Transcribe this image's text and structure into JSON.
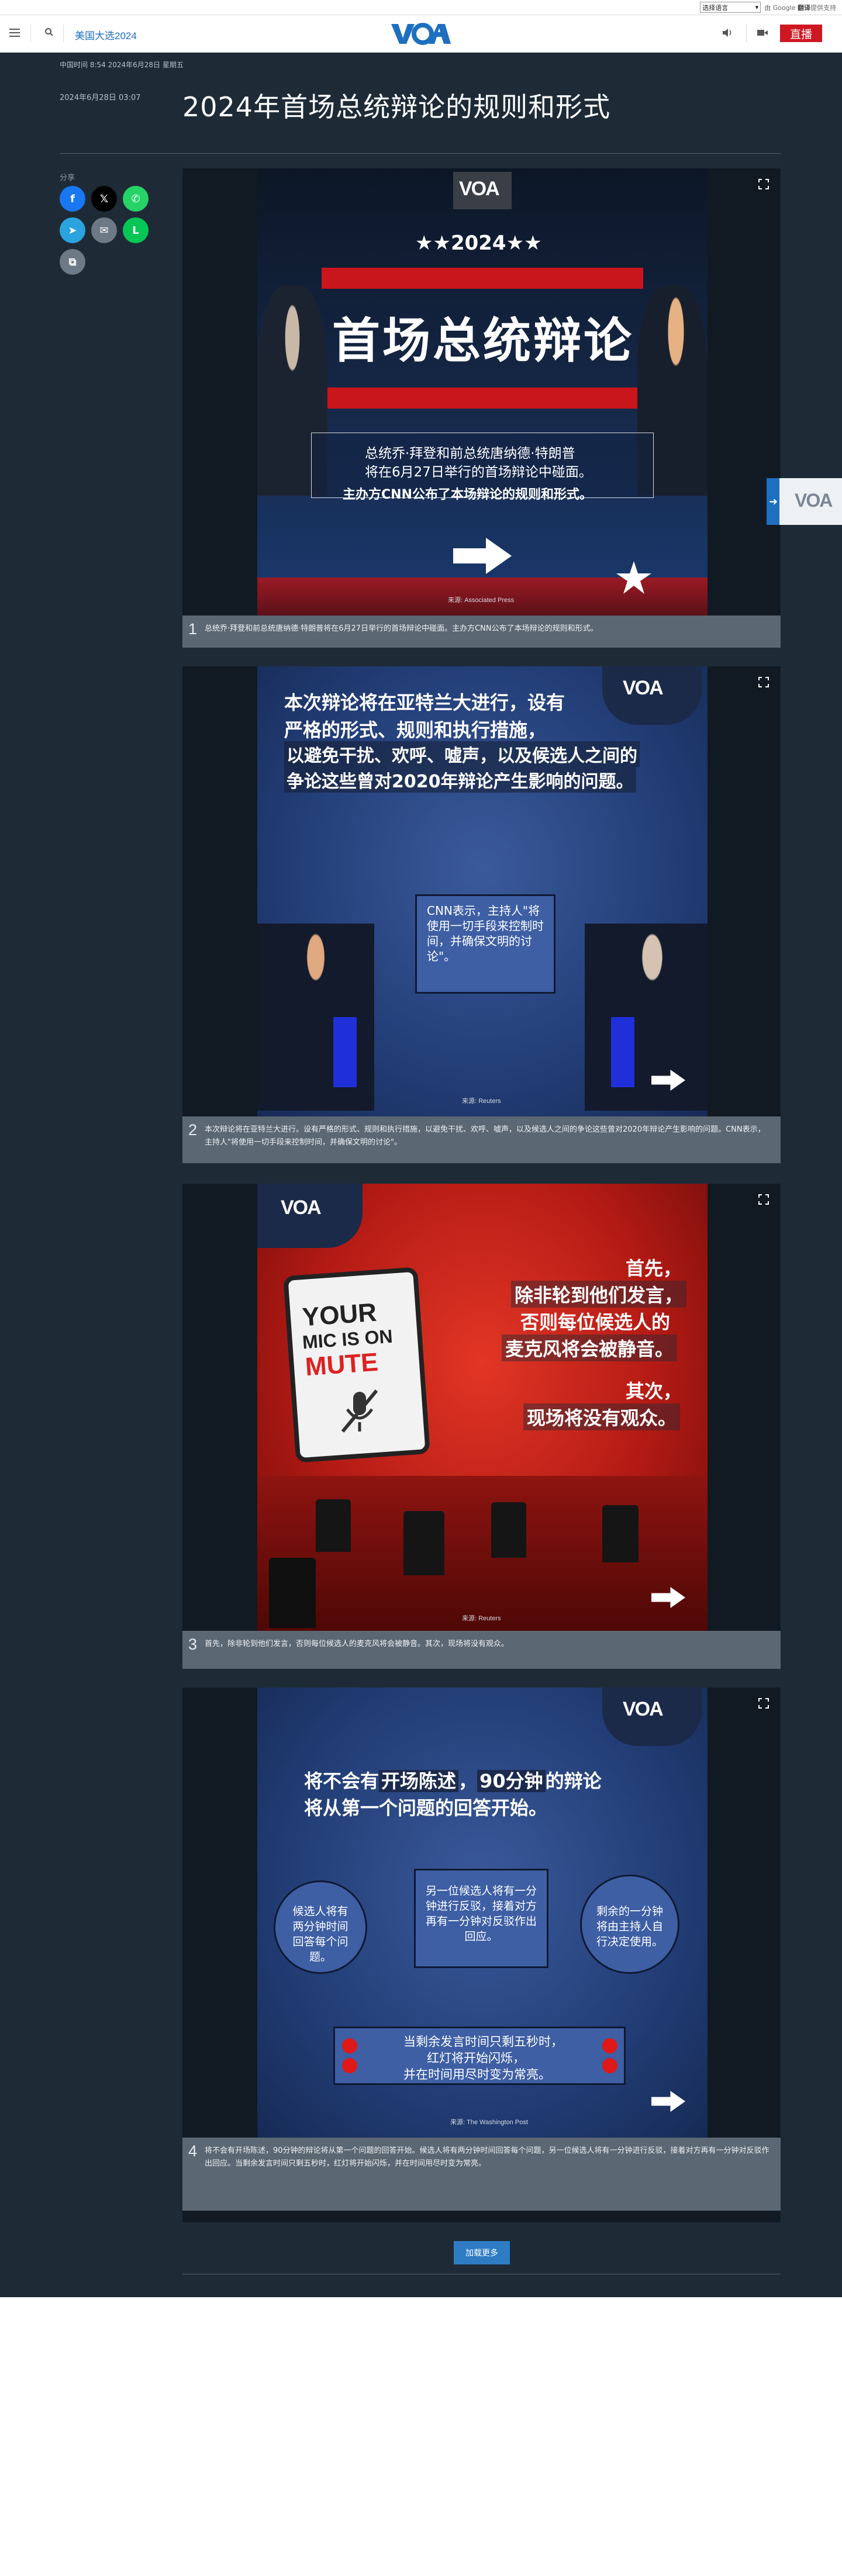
{
  "translate": {
    "select_label": "选择语言",
    "powered_prefix": "由 Google",
    "powered_brand": "翻译",
    "powered_suffix": "提供支持"
  },
  "header": {
    "section": "美国大选2024",
    "logo": "VOA",
    "live_label": "直播"
  },
  "article": {
    "meta_top": "中国时间 8:54 2024年6月28日 星期五",
    "date": "2024年6月28日 03:07",
    "title": "2024年首场总统辩论的规则和形式",
    "share_label": "分享"
  },
  "share_buttons": [
    {
      "name": "facebook",
      "glyph": "f",
      "color": "#1877f2"
    },
    {
      "name": "x",
      "glyph": "𝕏",
      "color": "#000000"
    },
    {
      "name": "whatsapp",
      "glyph": "✆",
      "color": "#25d366"
    },
    {
      "name": "telegram",
      "glyph": "➤",
      "color": "#2aa3de"
    },
    {
      "name": "email",
      "glyph": "✉",
      "color": "#6d7a86"
    },
    {
      "name": "line",
      "glyph": "L",
      "color": "#06c755"
    },
    {
      "name": "copy-link",
      "glyph": "⧉",
      "color": "#6d7a86"
    }
  ],
  "slides": [
    {
      "number": "1",
      "caption": "总统乔·拜登和前总统唐纳德·特朗普将在6月27日举行的首场辩论中碰面。主办方CNN公布了本场辩论的规则和形式。",
      "graphic": {
        "year": "★★2024★★",
        "headline": "首场总统辩论",
        "line1": "总统乔·拜登和前总统唐纳德·特朗普",
        "line2": "将在6月27日举行的首场辩论中碰面。",
        "line3": "主办方CNN公布了本场辩论的规则和形式。",
        "source": "来源: Associated Press"
      }
    },
    {
      "number": "2",
      "caption": "本次辩论将在亚特兰大进行。设有严格的形式、规则和执行措施，以避免干扰、欢呼、嘘声，以及候选人之间的争论这些曾对2020年辩论产生影响的问题。CNN表示，主持人\"将使用一切手段来控制时间，并确保文明的讨论\"。",
      "graphic": {
        "l1": "本次辩论将在亚特兰大进行，设有",
        "l2": "严格的形式、规则和执行措施，",
        "l3": "以避免干扰、欢呼、嘘声，以及候选人之间的",
        "l4": "争论这些曾对2020年辩论产生影响的问题。",
        "bubble": "CNN表示，主持人\"将使用一切手段来控制时间，并确保文明的讨论\"。",
        "source": "来源: Reuters"
      }
    },
    {
      "number": "3",
      "caption": "首先，除非轮到他们发言，否则每位候选人的麦克风将会被静音。其次，现场将没有观众。",
      "graphic": {
        "sign1": "YOUR",
        "sign2": "MIC IS ON",
        "sign3": "MUTE",
        "t1": "首先，",
        "t2": "除非轮到他们发言，",
        "t3": "否则每位候选人的",
        "t4": "麦克风将会被静音。",
        "t5": "其次，",
        "t6": "现场将没有观众。",
        "source": "来源: Reuters"
      }
    },
    {
      "number": "4",
      "caption": "将不会有开场陈述，90分钟的辩论将从第一个问题的回答开始。候选人将有两分钟时间回答每个问题，另一位候选人将有一分钟进行反驳，接着对方再有一分钟对反驳作出回应。当剩余发言时间只剩五秒时，红灯将开始闪烁，并在时间用尽时变为常亮。",
      "graphic": {
        "h1a": "将不会有",
        "h1b": "开场陈述",
        "h1c": "，",
        "h1d": "90分钟",
        "h1e": "的辩论",
        "h2": "将从第一个问题的回答开始。",
        "b1": "候选人将有两分钟时间回答每个问题。",
        "b2": "另一位候选人将有一分钟进行反驳，接着对方再有一分钟对反驳作出回应。",
        "b3": "剩余的一分钟将由主持人自行决定使用。",
        "bottom1": "当剩余发言时间只剩五秒时，",
        "bottom2": "红灯将开始闪烁，",
        "bottom3": "并在时间用尽时变为常亮。",
        "source": "来源: The Washington Post"
      }
    }
  ],
  "load_more": "加载更多",
  "float_tab_logo": "VOA"
}
